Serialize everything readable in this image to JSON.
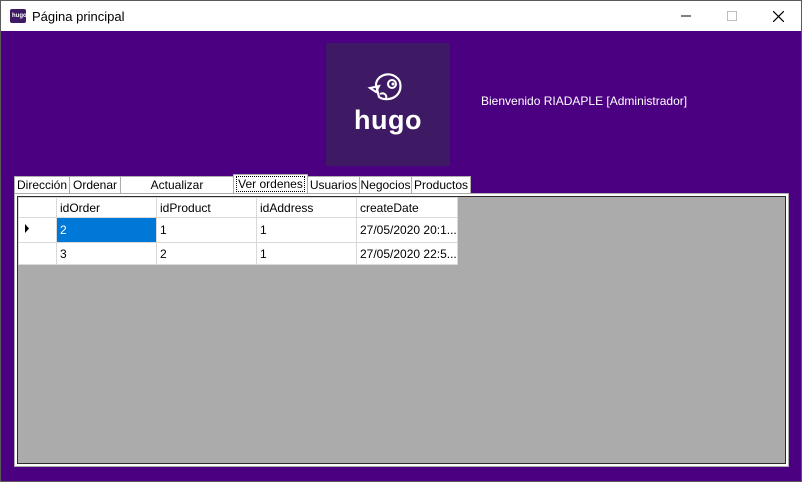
{
  "window": {
    "title": "Página principal"
  },
  "logo": {
    "text": "hugo",
    "icon_text": "hugo"
  },
  "welcome": {
    "text": "Bienvenido RIADAPLE [Administrador]"
  },
  "tabs": [
    {
      "label": "Dirección"
    },
    {
      "label": "Ordenar"
    },
    {
      "label": "Actualizar contraseña"
    },
    {
      "label": "Ver ordenes"
    },
    {
      "label": "Usuarios"
    },
    {
      "label": "Negocios"
    },
    {
      "label": "Productos"
    }
  ],
  "grid": {
    "columns": [
      "idOrder",
      "idProduct",
      "idAddress",
      "createDate"
    ],
    "rows": [
      {
        "cells": [
          "2",
          "1",
          "1",
          "27/05/2020 20:1..."
        ]
      },
      {
        "cells": [
          "3",
          "2",
          "1",
          "27/05/2020 22:5..."
        ]
      }
    ]
  },
  "colors": {
    "background": "#4b0082",
    "logo_bg": "#3d1a63",
    "grid_bg": "#ababab",
    "selection": "#0078d7"
  }
}
